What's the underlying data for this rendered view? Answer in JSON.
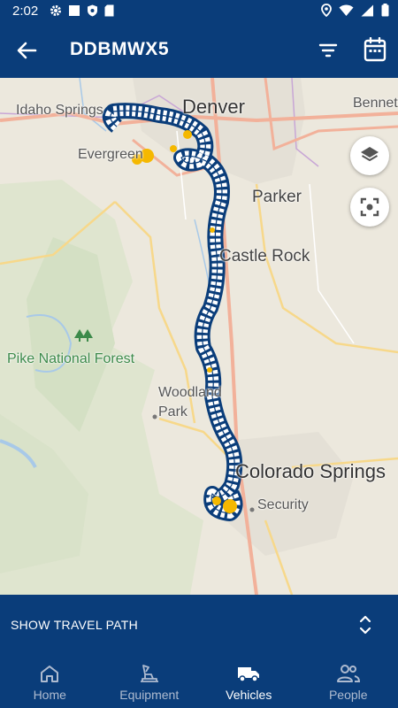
{
  "status_bar": {
    "time": "2:02"
  },
  "app_bar": {
    "title": "DDBMWX5"
  },
  "map": {
    "labels": {
      "denver": "Denver",
      "idaho_springs": "Idaho Springs",
      "evergreen": "Evergreen",
      "parker": "Parker",
      "castle_rock": "Castle Rock",
      "pike_national_forest": "Pike National Forest",
      "woodland_park": "Woodland Park",
      "colorado_springs": "Colorado Springs",
      "security": "Security",
      "bennett": "Bennett"
    },
    "colors": {
      "route": "#0a3d7a",
      "stop": "#f5b800"
    }
  },
  "travel_path": {
    "label": "SHOW TRAVEL PATH"
  },
  "bottom_nav": [
    {
      "label": "Home",
      "icon": "home-icon",
      "active": false
    },
    {
      "label": "Equipment",
      "icon": "excavator-icon",
      "active": false
    },
    {
      "label": "Vehicles",
      "icon": "truck-icon",
      "active": true
    },
    {
      "label": "People",
      "icon": "people-icon",
      "active": false
    }
  ]
}
